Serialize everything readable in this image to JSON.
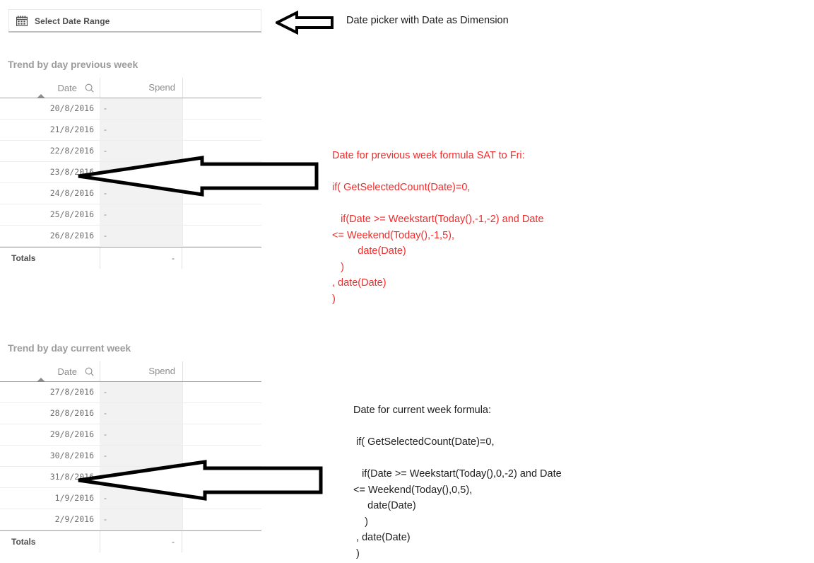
{
  "datepicker": {
    "icon": "calendar-icon",
    "label": "Select Date Range"
  },
  "annotations": {
    "datepicker_note": "Date picker with Date as Dimension",
    "previous_week_formula": "Date for previous week formula SAT to Fri:\n\nif( GetSelectedCount(Date)=0,\n\n   if(Date >= Weekstart(Today(),-1,-2) and Date\n<= Weekend(Today(),-1,5),\n         date(Date)\n   )\n, date(Date)\n)",
    "current_week_formula": "Date for current week formula:\n\n if( GetSelectedCount(Date)=0,\n\n   if(Date >= Weekstart(Today(),0,-2) and Date\n<= Weekend(Today(),0,5),\n     date(Date)\n    )\n , date(Date)\n )"
  },
  "tables": [
    {
      "title": "Trend by day previous week",
      "columns": [
        "Date",
        "Spend"
      ],
      "search_icon": "magnifier-icon",
      "sort_indicator": "sort-ascending-caret",
      "rows": [
        {
          "date": "20/8/2016",
          "spend": "-"
        },
        {
          "date": "21/8/2016",
          "spend": "-"
        },
        {
          "date": "22/8/2016",
          "spend": "-"
        },
        {
          "date": "23/8/2016",
          "spend": "-"
        },
        {
          "date": "24/8/2016",
          "spend": "-"
        },
        {
          "date": "25/8/2016",
          "spend": "-"
        },
        {
          "date": "26/8/2016",
          "spend": "-"
        }
      ],
      "totals_label": "Totals",
      "totals_spend": "-"
    },
    {
      "title": "Trend by day current week",
      "columns": [
        "Date",
        "Spend"
      ],
      "search_icon": "magnifier-icon",
      "sort_indicator": "sort-ascending-caret",
      "rows": [
        {
          "date": "27/8/2016",
          "spend": "-"
        },
        {
          "date": "28/8/2016",
          "spend": "-"
        },
        {
          "date": "29/8/2016",
          "spend": "-"
        },
        {
          "date": "30/8/2016",
          "spend": "-"
        },
        {
          "date": "31/8/2016",
          "spend": "-"
        },
        {
          "date": "1/9/2016",
          "spend": "-"
        },
        {
          "date": "2/9/2016",
          "spend": "-"
        }
      ],
      "totals_label": "Totals",
      "totals_spend": "-"
    }
  ],
  "colors": {
    "formula_red": "#f22b2b",
    "title_gray": "#9c9c9c",
    "spend_column_fill": "#f2f2f2",
    "arrow_stroke": "#000000"
  }
}
